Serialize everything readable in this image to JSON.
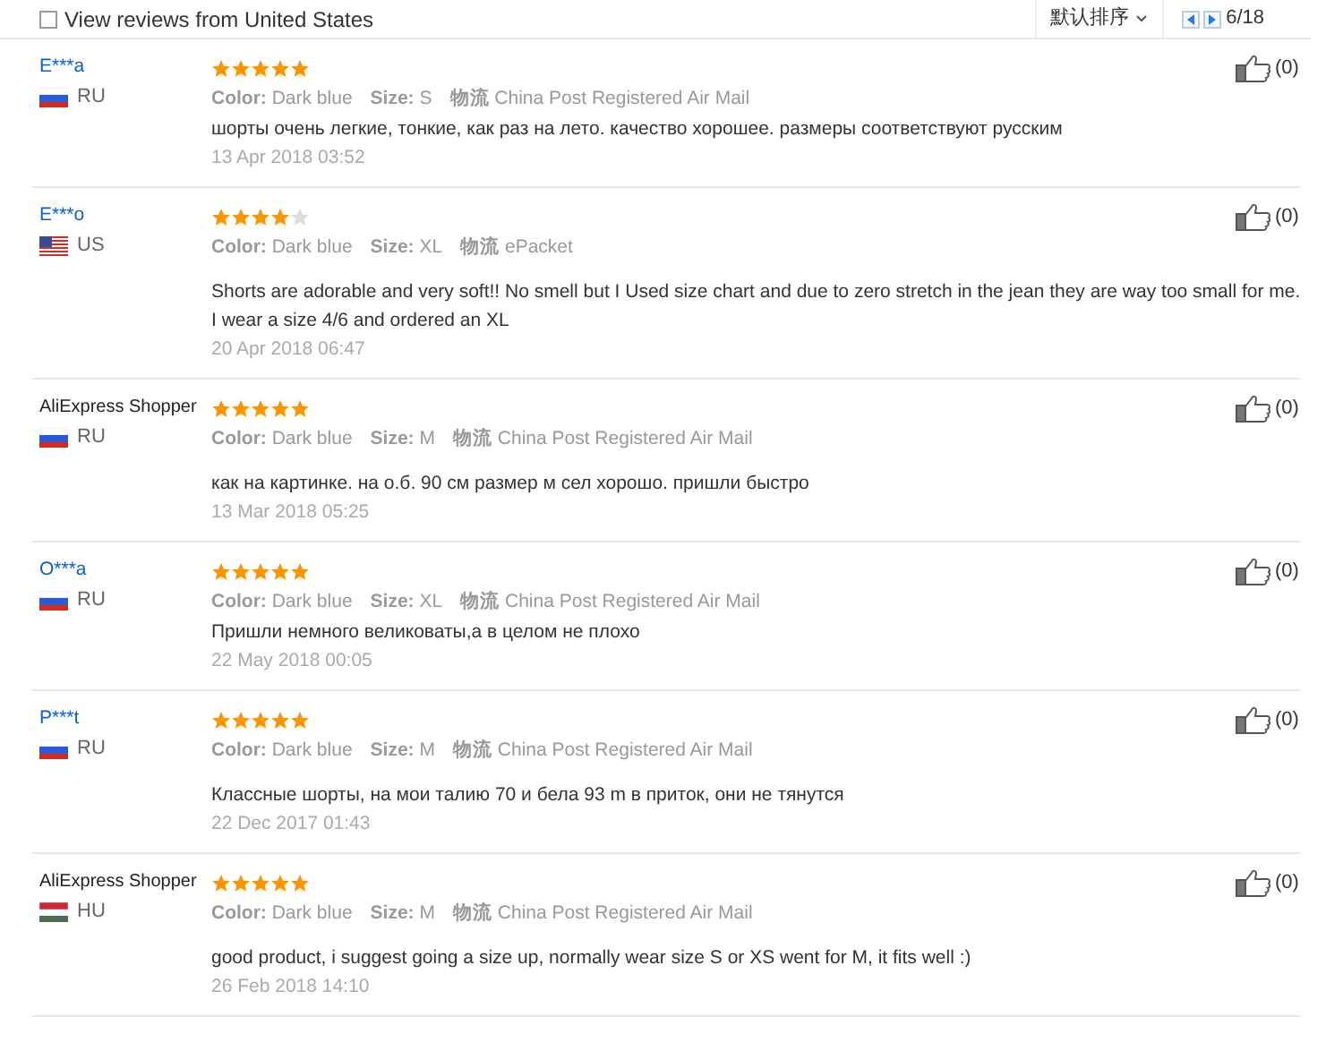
{
  "filter": {
    "label": "View reviews from United States",
    "checked": false
  },
  "sort": {
    "label": "默认排序"
  },
  "pager": {
    "page": "6/18"
  },
  "reviews": [
    {
      "name": "E***a",
      "kind": "link",
      "flag": {
        "kind": "ru"
      },
      "country": "RU",
      "stars": 5,
      "color_label": "Color:",
      "color_value": "Dark blue",
      "size_label": "Size:",
      "size": "S",
      "shipping_label": "物流",
      "shipping": "China Post Registered Air Mail",
      "gap": false,
      "text": "шорты очень легкие, тонкие, как раз на лето. качество хорошее. размеры соответствуют русским",
      "date": "13 Apr 2018 03:52",
      "likes": "(0)"
    },
    {
      "name": "E***o",
      "kind": "link",
      "flag": {
        "kind": "us"
      },
      "country": "US",
      "stars": 4,
      "color_label": "Color:",
      "color_value": "Dark blue",
      "size_label": "Size:",
      "size": "XL",
      "shipping_label": "物流",
      "shipping": "ePacket",
      "gap": true,
      "text": "Shorts are adorable and very soft!! No smell but I Used size chart and due to zero stretch in the jean they are way too small for me. I wear a size 4/6 and ordered an XL",
      "date": "20 Apr 2018 06:47",
      "likes": "(0)"
    },
    {
      "name": "AliExpress Shopper",
      "kind": "plain",
      "flag": {
        "kind": "ru"
      },
      "country": "RU",
      "stars": 5,
      "color_label": "Color:",
      "color_value": "Dark blue",
      "size_label": "Size:",
      "size": "M",
      "shipping_label": "物流",
      "shipping": "China Post Registered Air Mail",
      "gap": true,
      "text": "как на картинке. на о.б. 90 см размер м сел хорошо. пришли быстро",
      "date": "13 Mar 2018 05:25",
      "likes": "(0)"
    },
    {
      "name": "O***a",
      "kind": "link",
      "flag": {
        "kind": "ru"
      },
      "country": "RU",
      "stars": 5,
      "color_label": "Color:",
      "color_value": "Dark blue",
      "size_label": "Size:",
      "size": "XL",
      "shipping_label": "物流",
      "shipping": "China Post Registered Air Mail",
      "gap": false,
      "text": "Пришли немного великоваты,а в целом не плохо",
      "date": "22 May 2018 00:05",
      "likes": "(0)"
    },
    {
      "name": "P***t",
      "kind": "link",
      "flag": {
        "kind": "ru"
      },
      "country": "RU",
      "stars": 5,
      "color_label": "Color:",
      "color_value": "Dark blue",
      "size_label": "Size:",
      "size": "M",
      "shipping_label": "物流",
      "shipping": "China Post Registered Air Mail",
      "gap": true,
      "text": "Классные шорты, на мои талию 70 и бела 93 m в приток, они не тянутся",
      "date": "22 Dec 2017 01:43",
      "likes": "(0)"
    },
    {
      "name": "AliExpress Shopper",
      "kind": "plain",
      "flag": {
        "kind": "hu"
      },
      "country": "HU",
      "stars": 5,
      "color_label": "Color:",
      "color_value": "Dark blue",
      "size_label": "Size:",
      "size": "M",
      "shipping_label": "物流",
      "shipping": "China Post Registered Air Mail",
      "gap": true,
      "text": "good product, i suggest going a size up, normally wear size S or XS went for M, it fits well :)",
      "date": "26 Feb 2018 14:10",
      "likes": "(0)"
    }
  ]
}
